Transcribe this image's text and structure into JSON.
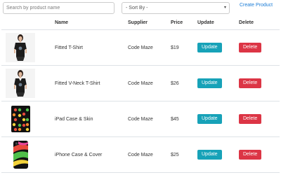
{
  "toolbar": {
    "search_placeholder": "Search by product name",
    "sort_value": "- Sort By -",
    "create_label": "Create Product"
  },
  "table": {
    "columns": [
      "",
      "Name",
      "Supplier",
      "Price",
      "Update",
      "Delete"
    ],
    "rows": [
      {
        "image": "black-tshirt-photo",
        "name": "Fitted T-Shirt",
        "supplier": "Code Maze",
        "price": "$19",
        "update": "Update",
        "delete": "Delete"
      },
      {
        "image": "black-vneck-tshirt-photo",
        "name": "Fitted V-Neck T-Shirt",
        "supplier": "Code Maze",
        "price": "$26",
        "update": "Update",
        "delete": "Delete"
      },
      {
        "image": "ipad-case-photo",
        "name": "iPad Case & Skin",
        "supplier": "Code Maze",
        "price": "$45",
        "update": "Update",
        "delete": "Delete"
      },
      {
        "image": "iphone-case-photo",
        "name": "iPhone Case & Cover",
        "supplier": "Code Maze",
        "price": "$25",
        "update": "Update",
        "delete": "Delete"
      }
    ]
  },
  "colors": {
    "update_button": "#17a2b8",
    "delete_button": "#dc3545",
    "link": "#1a7bd6"
  }
}
